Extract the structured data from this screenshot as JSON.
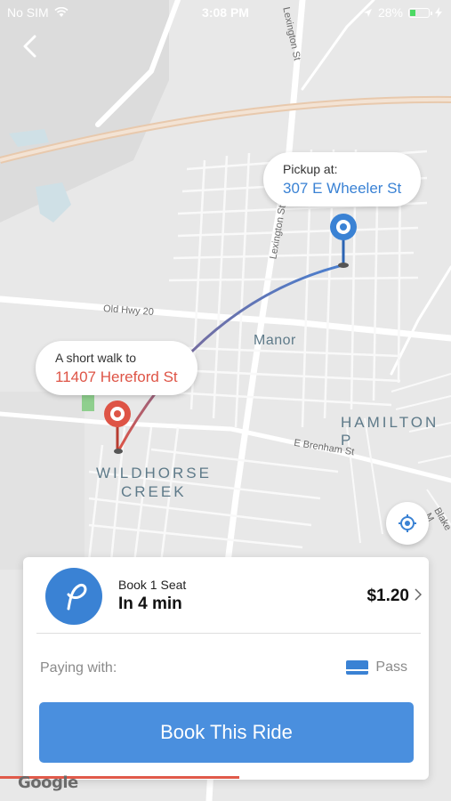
{
  "status_bar": {
    "carrier": "No SIM",
    "time": "3:08 PM",
    "battery_percent": "28%"
  },
  "map": {
    "labels": {
      "manor": "Manor",
      "hamilton": "HAMILTON P",
      "wildhorse_line1": "WILDHORSE",
      "wildhorse_line2": "CREEK"
    },
    "streets": {
      "lexington_top": "Lexington St",
      "lexington_mid": "Lexington St",
      "old_hwy": "Old Hwy 20",
      "e_brenham": "E Brenham St",
      "blake": "Blake M"
    },
    "route_color_start": "#de5446",
    "route_color_end": "#4a7fcf"
  },
  "pickup": {
    "label": "Pickup at:",
    "address": "307 E Wheeler St"
  },
  "walk": {
    "label": "A short walk to",
    "address": "11407 Hereford St"
  },
  "ride": {
    "seat_label": "Book 1 Seat",
    "eta": "In 4 min",
    "price": "$1.20",
    "paying_with_label": "Paying with:",
    "payment_method": "Pass",
    "book_label": "Book This Ride",
    "progress": 0.53
  },
  "colors": {
    "accent": "#3a82d4",
    "walk": "#de5446",
    "button": "#4a8fde"
  },
  "google_logo": "Google"
}
